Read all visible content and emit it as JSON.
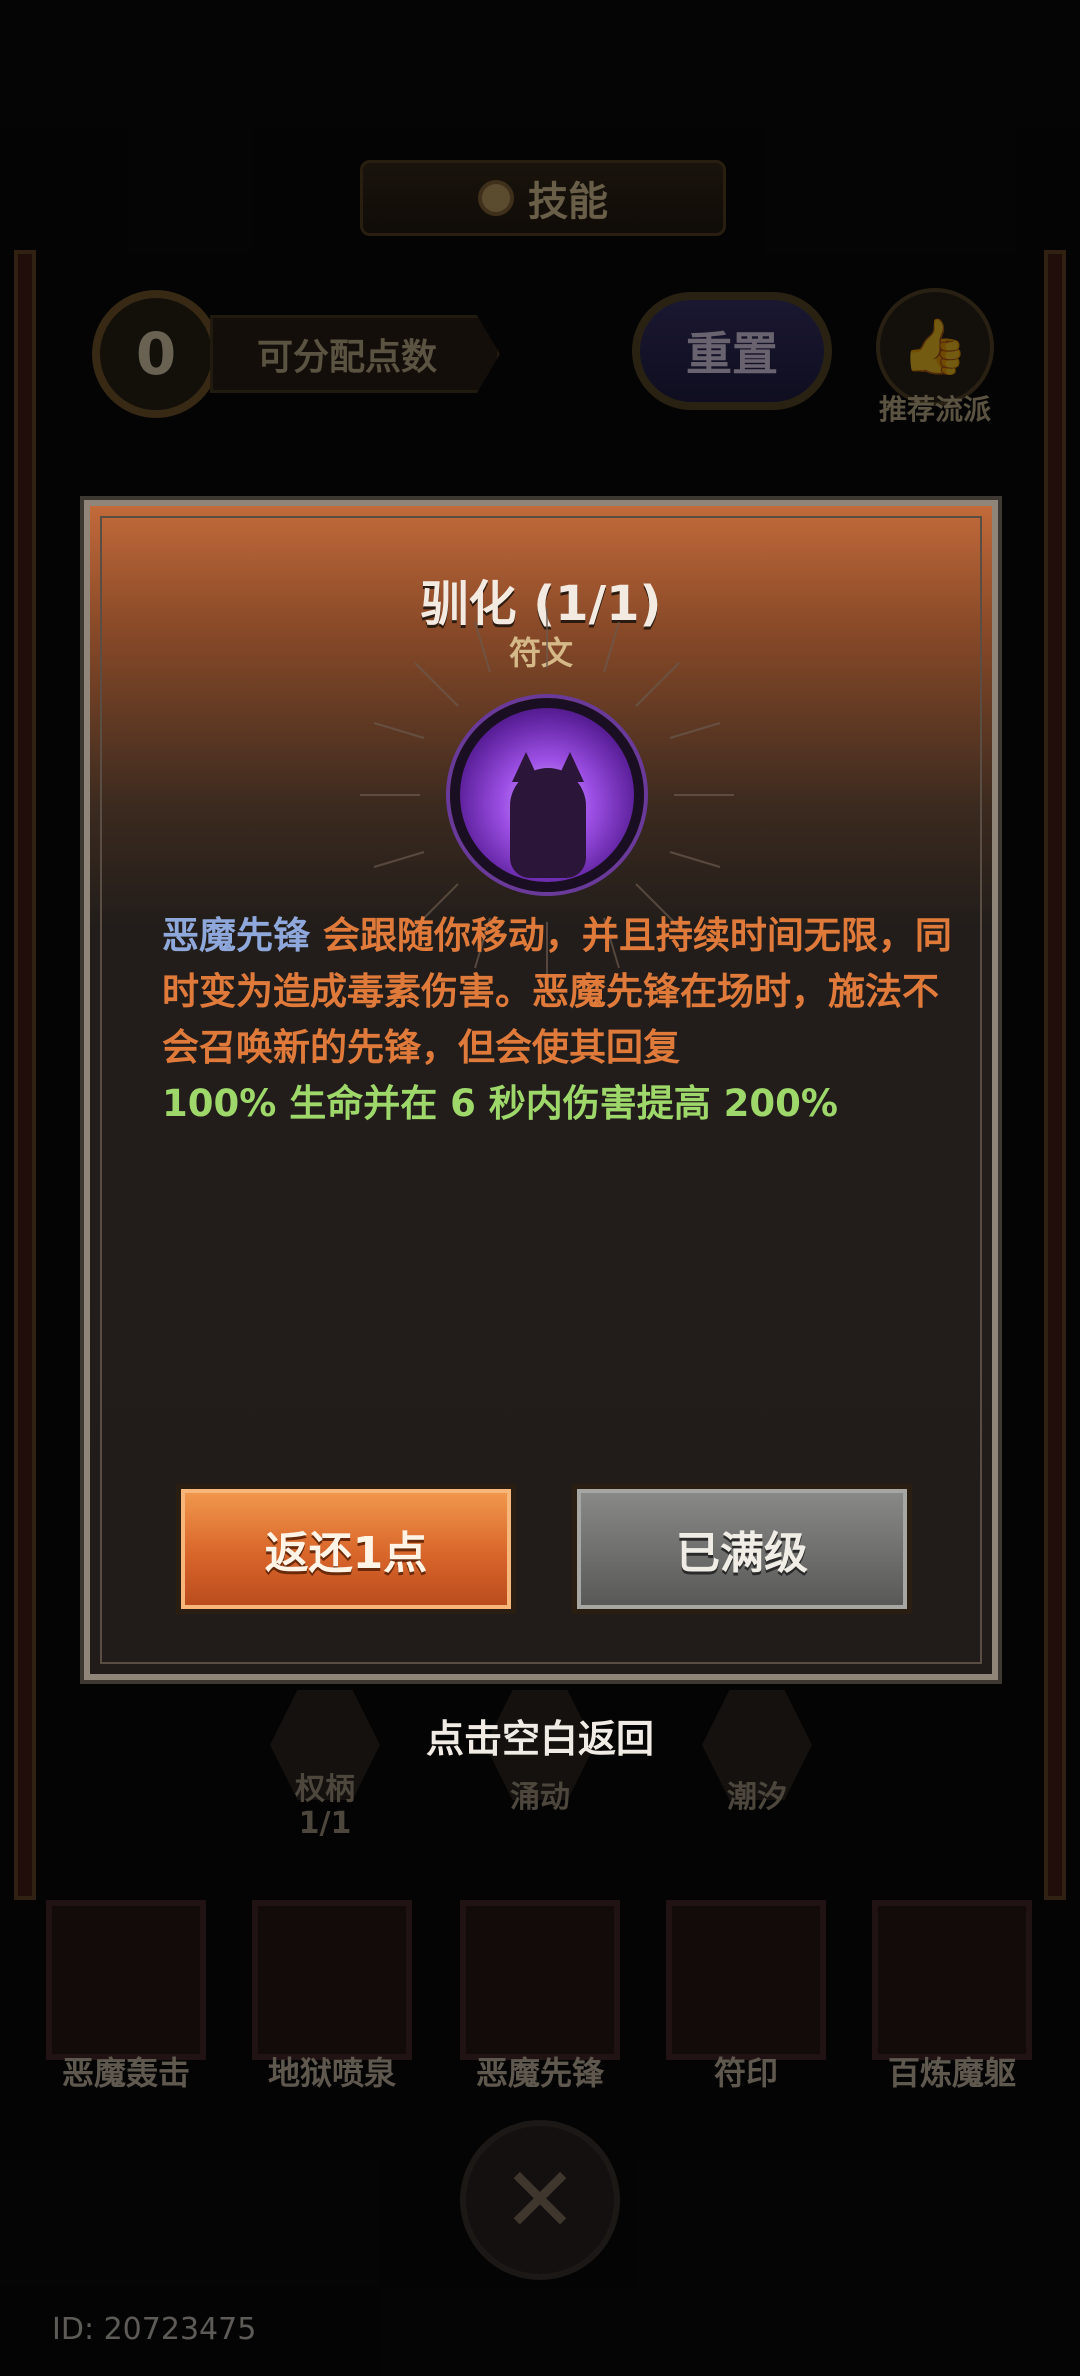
{
  "header": {
    "title": "技能"
  },
  "points": {
    "value": "0",
    "label": "可分配点数"
  },
  "reset": {
    "label": "重置"
  },
  "recommend": {
    "label": "推荐流派"
  },
  "tree": {
    "nodes": [
      {
        "name": "权柄",
        "level": "1/1"
      },
      {
        "name": "涌动",
        "level": ""
      },
      {
        "name": "潮汐",
        "level": ""
      }
    ]
  },
  "skills": [
    "恶魔轰击",
    "地狱喷泉",
    "恶魔先锋",
    "符印",
    "百炼魔躯"
  ],
  "player": {
    "id": "ID: 20723475"
  },
  "modal": {
    "title": "驯化 (1/1)",
    "subtitle": "符文",
    "icon": "purple-cat-rune-icon",
    "desc": {
      "kw1": "恶魔先锋",
      "t1": " 会跟随你移动，并且持续时间无限，同时变为造成毒素伤害。恶魔先锋在场时，施法不会召唤新的先锋，但会使其回复",
      "v1": "100%",
      "t2": " 生命并在 ",
      "v2": "6",
      "t3": " 秒内伤害提高 ",
      "v3": "200%"
    },
    "refund_label": "返还1点",
    "maxed_label": "已满级"
  },
  "hint": "点击空白返回",
  "colors": {
    "keyword": "#8fa8dc",
    "highlight": "#9ed86a",
    "body": "#e07a3a",
    "refund": "#d8652a"
  }
}
